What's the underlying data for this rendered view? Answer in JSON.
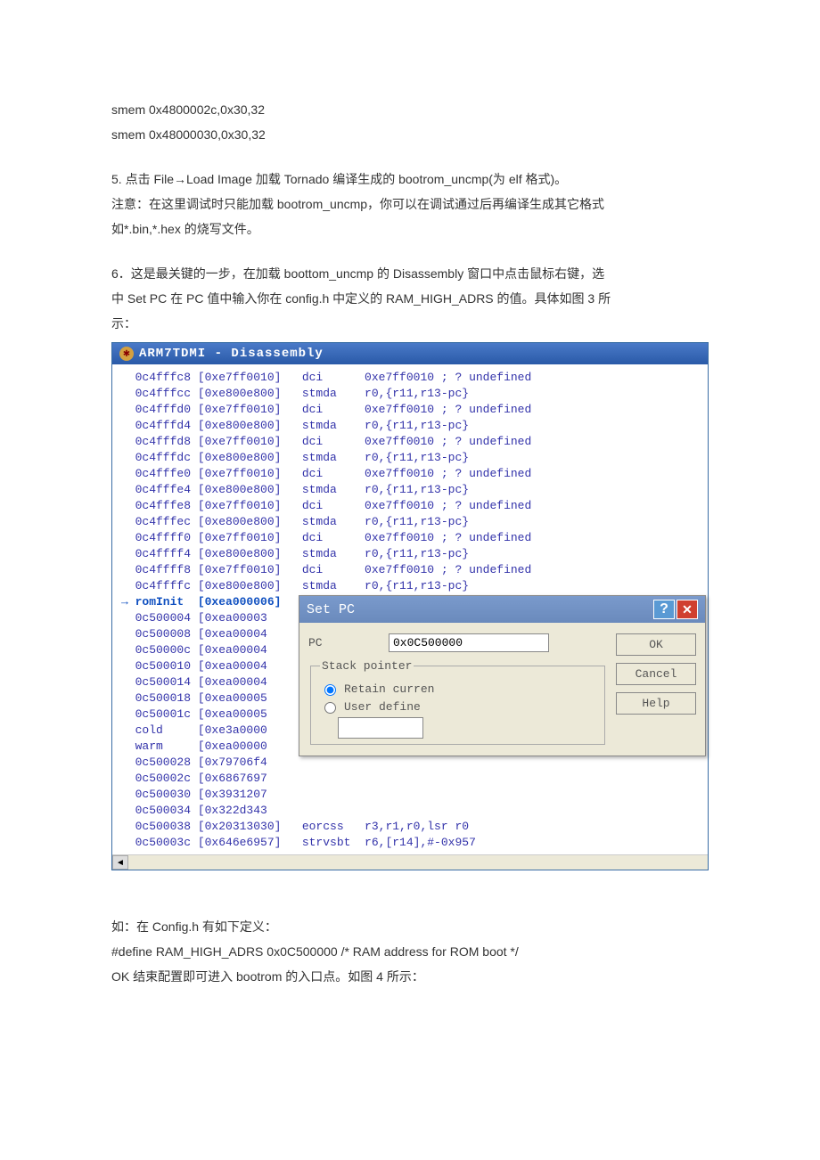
{
  "intro": {
    "line1": "smem 0x4800002c,0x30,32",
    "line2": "smem 0x48000030,0x30,32",
    "line5a": "5.  点击 File→Load Image  加载 Tornado  编译生成的 bootrom_uncmp(为 elf  格式)。",
    "line5b": "注意：在这里调试时只能加载 bootrom_uncmp，你可以在调试通过后再编译生成其它格式",
    "line5c": "如*.bin,*.hex 的烧写文件。",
    "line6a": "6．这是最关键的一步，在加载 boottom_uncmp  的 Disassembly  窗口中点击鼠标右键，选",
    "line6b": "中 Set PC  在 PC  值中输入你在 config.h  中定义的 RAM_HIGH_ADRS  的值。具体如图 3 所",
    "line6c": "示："
  },
  "window": {
    "title": "ARM7TDMI - Disassembly",
    "lines": [
      "  0c4fffc8 [0xe7ff0010]   dci      0xe7ff0010 ; ? undefined",
      "  0c4fffcc [0xe800e800]   stmda    r0,{r11,r13-pc}",
      "  0c4fffd0 [0xe7ff0010]   dci      0xe7ff0010 ; ? undefined",
      "  0c4fffd4 [0xe800e800]   stmda    r0,{r11,r13-pc}",
      "  0c4fffd8 [0xe7ff0010]   dci      0xe7ff0010 ; ? undefined",
      "  0c4fffdc [0xe800e800]   stmda    r0,{r11,r13-pc}",
      "  0c4fffe0 [0xe7ff0010]   dci      0xe7ff0010 ; ? undefined",
      "  0c4fffe4 [0xe800e800]   stmda    r0,{r11,r13-pc}",
      "  0c4fffe8 [0xe7ff0010]   dci      0xe7ff0010 ; ? undefined",
      "  0c4fffec [0xe800e800]   stmda    r0,{r11,r13-pc}",
      "  0c4ffff0 [0xe7ff0010]   dci      0xe7ff0010 ; ? undefined",
      "  0c4ffff4 [0xe800e800]   stmda    r0,{r11,r13-pc}",
      "  0c4ffff8 [0xe7ff0010]   dci      0xe7ff0010 ; ? undefined",
      "  0c4ffffc [0xe800e800]   stmda    r0,{r11,r13-pc}",
      "→ romInit  [0xea000006]   b        cold",
      "  0c500004 [0xea00003",
      "  0c500008 [0xea00004",
      "  0c50000c [0xea00004",
      "  0c500010 [0xea00004",
      "  0c500014 [0xea00004",
      "  0c500018 [0xea00005",
      "  0c50001c [0xea00005",
      "  cold     [0xe3a0000",
      "  warm     [0xea00000",
      "  0c500028 [0x79706f4",
      "  0c50002c [0x6867697",
      "  0c500030 [0x3931207",
      "  0c500034 [0x322d343",
      "  0c500038 [0x20313030]   eorcss   r3,r1,r0,lsr r0",
      "  0c50003c [0x646e6957]   strvsbt  r6,[r14],#-0x957"
    ]
  },
  "dialog": {
    "title": "Set PC",
    "pc_label": "PC",
    "pc_value": "0x0C500000",
    "fieldset_label": "Stack pointer",
    "radio1": "Retain curren",
    "radio2": "User define",
    "ok": "OK",
    "cancel": "Cancel",
    "help": "Help"
  },
  "after": {
    "line1": "如：在 Config.h  有如下定义：",
    "line2": "#define RAM_HIGH_ADRS 0x0C500000 /* RAM address for ROM boot */",
    "line3": "OK  结束配置即可进入 bootrom  的入口点。如图 4 所示："
  }
}
